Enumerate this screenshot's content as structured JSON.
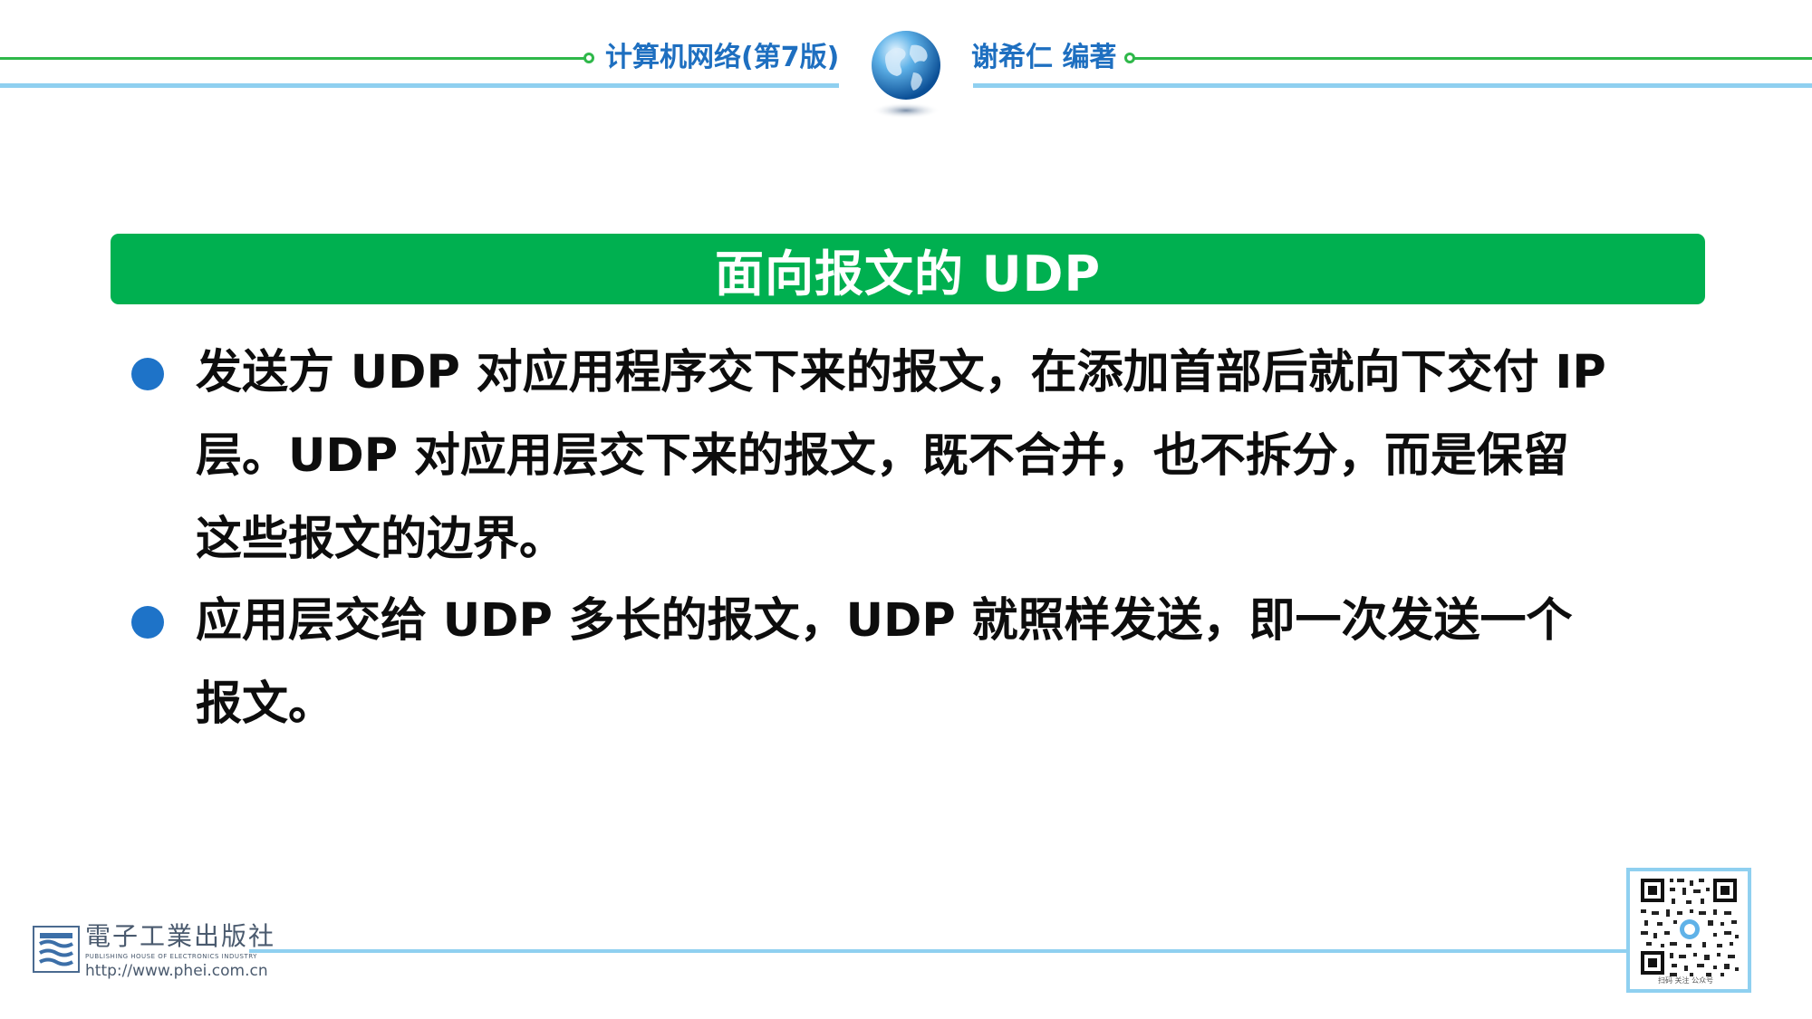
{
  "header": {
    "book_title": "计算机网络(第7版)",
    "author": "谢希仁 编著",
    "accent_green": "#2fb84a",
    "accent_blue": "#8fd0f0",
    "text_blue": "#1e6fc0"
  },
  "title": {
    "text": "面向报文的 UDP",
    "background": "#00b050"
  },
  "bullets": [
    {
      "lines": [
        "发送方 UDP 对应用程序交下来的报文，在添加首部后就向下交付 IP",
        "层。UDP 对应用层交下来的报文，既不合并，也不拆分，而是保留",
        "这些报文的边界。"
      ]
    },
    {
      "lines": [
        "应用层交给 UDP 多长的报文，UDP 就照样发送，即一次发送一个",
        "报文。"
      ]
    }
  ],
  "footer": {
    "publisher_name": "電子工業出版社",
    "publisher_en": "PUBLISHING HOUSE OF ELECTRONICS INDUSTRY",
    "publisher_url": "http://www.phei.com.cn",
    "qr_caption": "扫码 关注 公众号"
  },
  "icons": {
    "globe": "globe-icon",
    "publisher_logo": "publisher-logo-icon",
    "qr_code": "qr-code-icon"
  }
}
